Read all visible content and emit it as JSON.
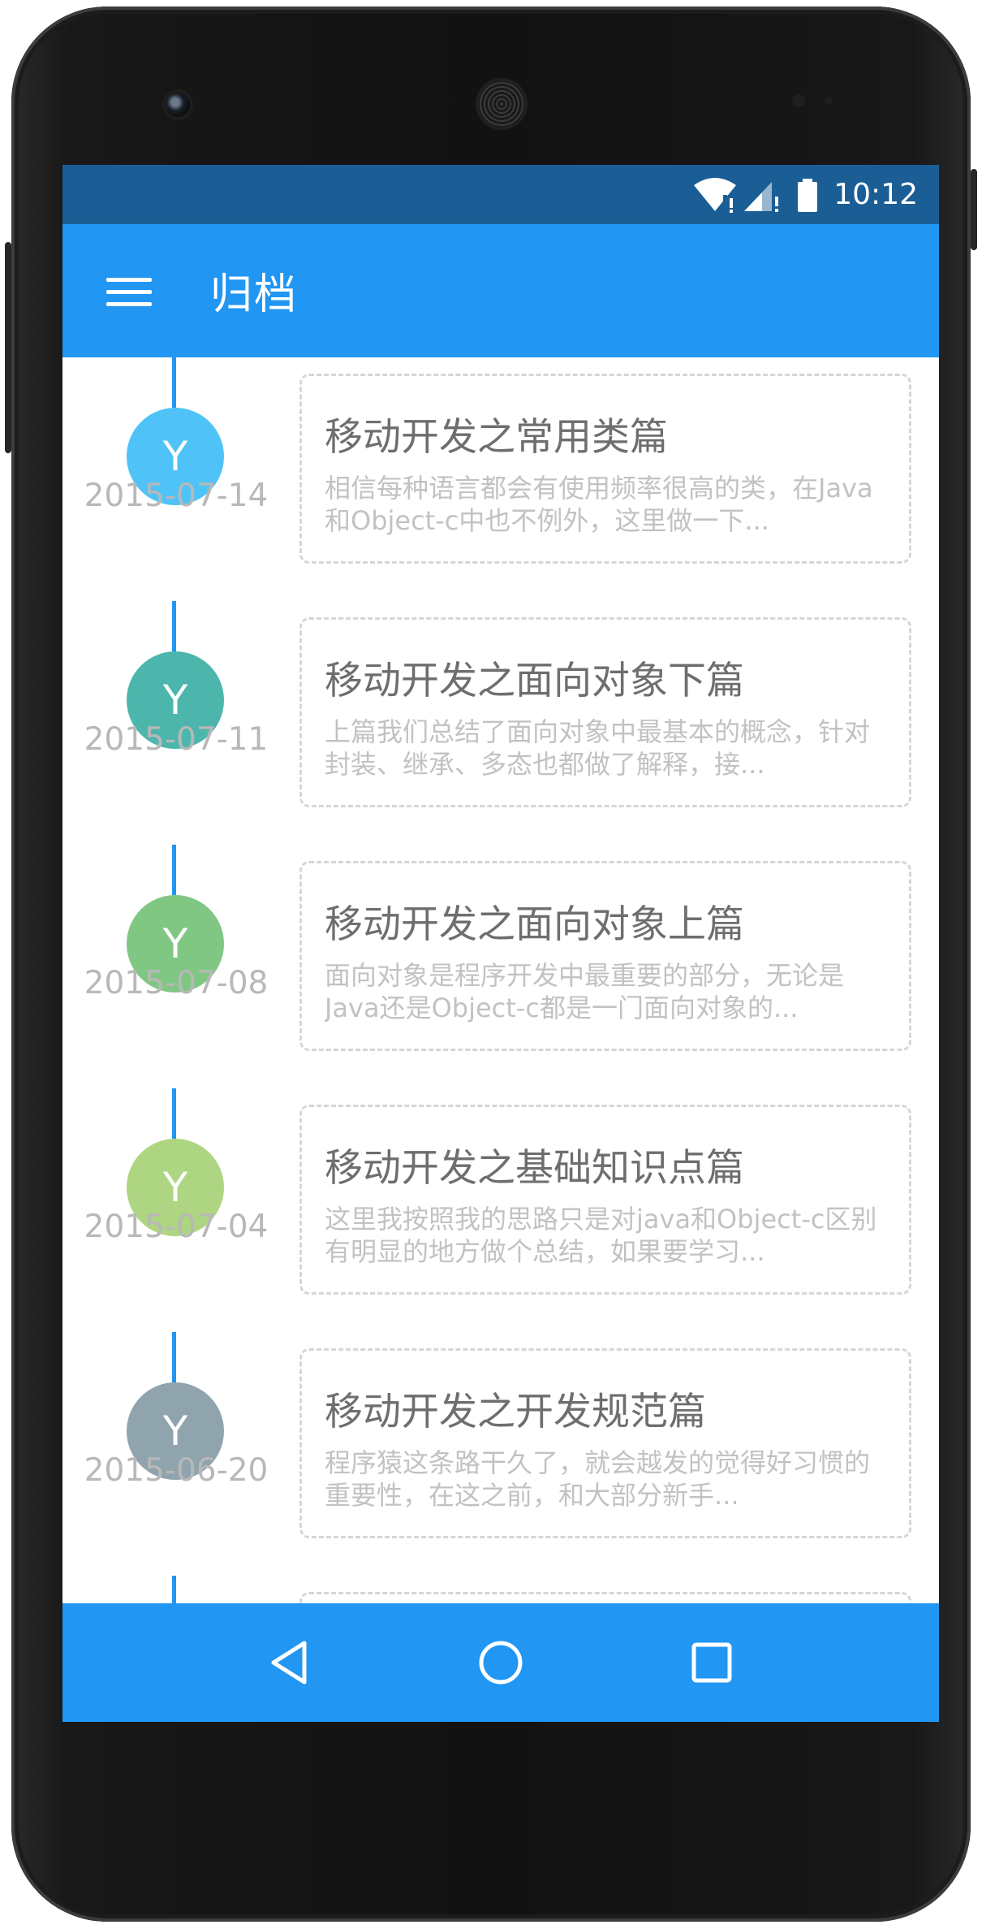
{
  "status_bar": {
    "time": "10:12",
    "icons": [
      "wifi-icon",
      "cell-signal-icon",
      "battery-icon"
    ]
  },
  "app_bar": {
    "title": "归档",
    "menu_icon": "menu-icon"
  },
  "timeline": {
    "accent_color": "#2196f3",
    "items": [
      {
        "avatar_letter": "Y",
        "avatar_color": "#4fc3f7",
        "date": "2015-07-14",
        "title": "移动开发之常用类篇",
        "excerpt": "相信每种语言都会有使用频率很高的类，在Java和Object-c中也不例外，这里做一下..."
      },
      {
        "avatar_letter": "Y",
        "avatar_color": "#4db6ac",
        "date": "2015-07-11",
        "title": "移动开发之面向对象下篇",
        "excerpt": "上篇我们总结了面向对象中最基本的概念，针对封装、继承、多态也都做了解释，接..."
      },
      {
        "avatar_letter": "Y",
        "avatar_color": "#81c784",
        "date": "2015-07-08",
        "title": "移动开发之面向对象上篇",
        "excerpt": "面向对象是程序开发中最重要的部分，无论是Java还是Object-c都是一门面向对象的..."
      },
      {
        "avatar_letter": "Y",
        "avatar_color": "#aed581",
        "date": "2015-07-04",
        "title": "移动开发之基础知识点篇",
        "excerpt": "这里我按照我的思路只是对java和Object-c区别有明显的地方做个总结，如果要学习..."
      },
      {
        "avatar_letter": "Y",
        "avatar_color": "#90a4ae",
        "date": "2015-06-20",
        "title": "移动开发之开发规范篇",
        "excerpt": "程序猿这条路干久了，就会越发的觉得好习惯的重要性，在这之前，和大部分新手..."
      }
    ]
  },
  "nav_bar": {
    "buttons": [
      "back-icon",
      "home-icon",
      "recents-icon"
    ]
  }
}
